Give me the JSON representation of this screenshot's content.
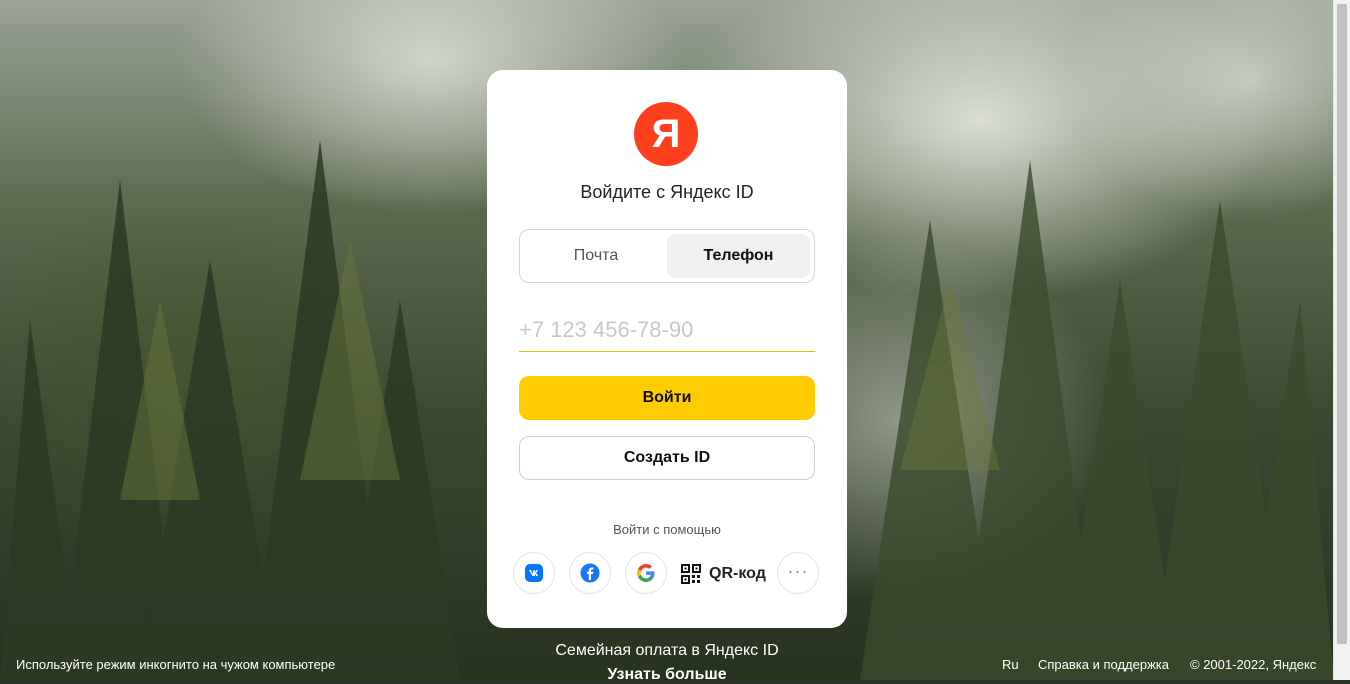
{
  "card": {
    "logo_letter": "Я",
    "title": "Войдите с Яндекс ID",
    "tabs": [
      {
        "label": "Почта",
        "active": false
      },
      {
        "label": "Телефон",
        "active": true
      }
    ],
    "phone_placeholder": "+7 123 456-78-90",
    "login_label": "Войти",
    "create_label": "Создать ID",
    "alt_login_label": "Войти с помощью",
    "social": [
      {
        "name": "vk",
        "icon": "vk-icon"
      },
      {
        "name": "facebook",
        "icon": "facebook-icon"
      },
      {
        "name": "google",
        "icon": "google-icon"
      }
    ],
    "qr_label": "QR-код",
    "more_label": "···"
  },
  "promo": {
    "title": "Семейная оплата в Яндекс ID",
    "link": "Узнать больше"
  },
  "footer": {
    "incognito_hint": "Используйте режим инкогнито на чужом компьютере",
    "language": "Ru",
    "help": "Справка и поддержка",
    "copyright": "© 2001-2022, Яндекс"
  },
  "colors": {
    "brand_red": "#fc3f1d",
    "brand_yellow": "#fecc00"
  }
}
